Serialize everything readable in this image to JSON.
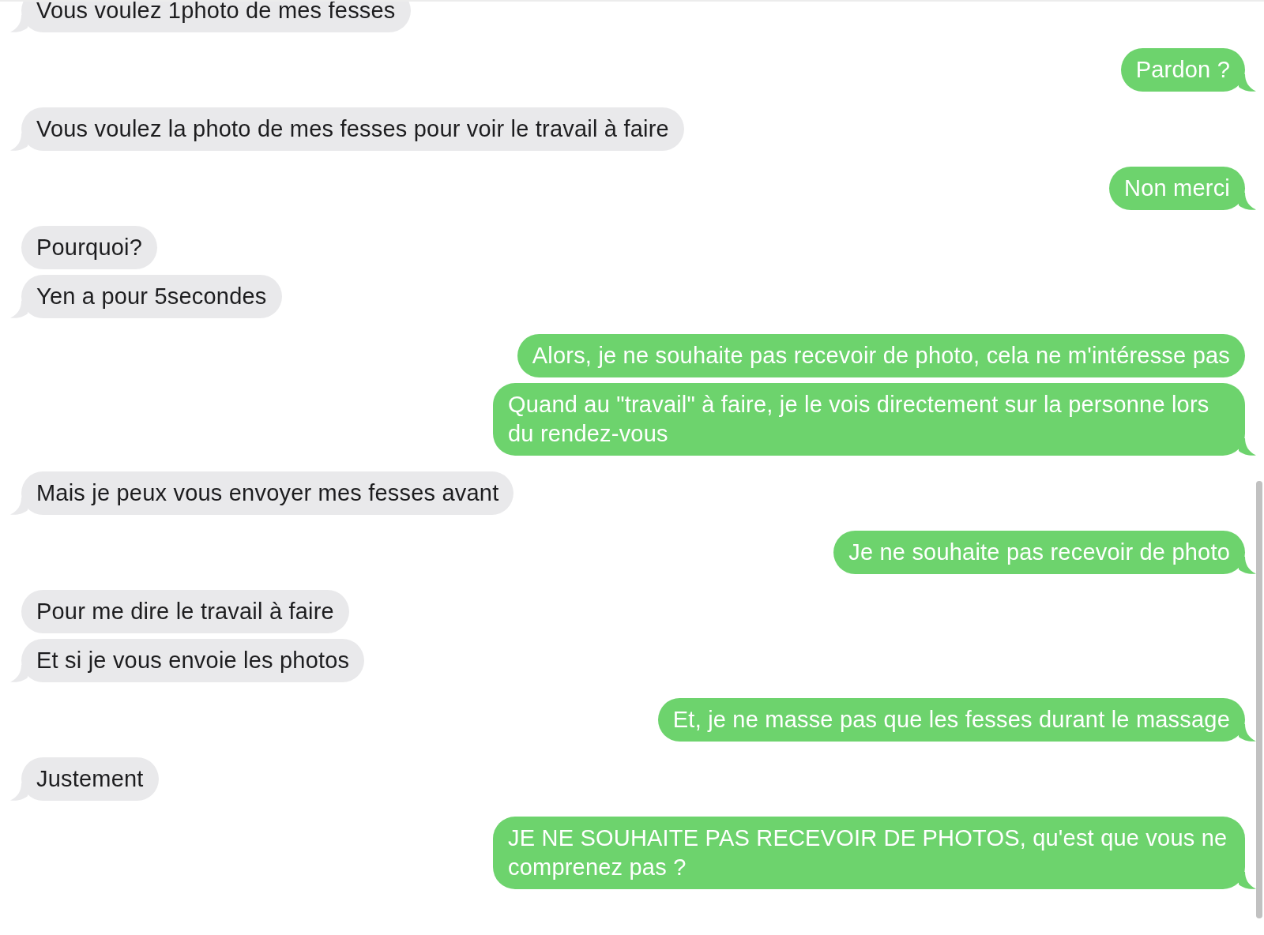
{
  "conversation": [
    {
      "kind": "received",
      "messages": [
        "Vous voulez 1photo de mes fesses"
      ]
    },
    {
      "kind": "sent",
      "messages": [
        "Pardon ?"
      ]
    },
    {
      "kind": "received",
      "messages": [
        "Vous voulez la photo de mes fesses pour voir le travail à faire"
      ]
    },
    {
      "kind": "sent",
      "messages": [
        "Non merci"
      ]
    },
    {
      "kind": "received",
      "messages": [
        "Pourquoi?",
        "Yen a pour 5secondes"
      ]
    },
    {
      "kind": "sent",
      "messages": [
        "Alors, je ne souhaite pas recevoir de photo, cela ne m'intéresse pas",
        "Quand au \"travail\" à faire, je le vois directement sur la personne lors du rendez-vous"
      ]
    },
    {
      "kind": "received",
      "messages": [
        "Mais je peux vous envoyer mes fesses avant"
      ]
    },
    {
      "kind": "sent",
      "messages": [
        "Je ne souhaite pas recevoir de photo"
      ]
    },
    {
      "kind": "received",
      "messages": [
        "Pour me dire le travail à faire",
        "Et si je vous envoie les photos"
      ]
    },
    {
      "kind": "sent",
      "messages": [
        "Et, je ne masse pas que les fesses durant le massage"
      ]
    },
    {
      "kind": "received",
      "messages": [
        "Justement"
      ]
    },
    {
      "kind": "sent",
      "messages": [
        "JE NE SOUHAITE PAS RECEVOIR DE PHOTOS, qu'est que vous ne comprenez pas ?"
      ]
    }
  ]
}
